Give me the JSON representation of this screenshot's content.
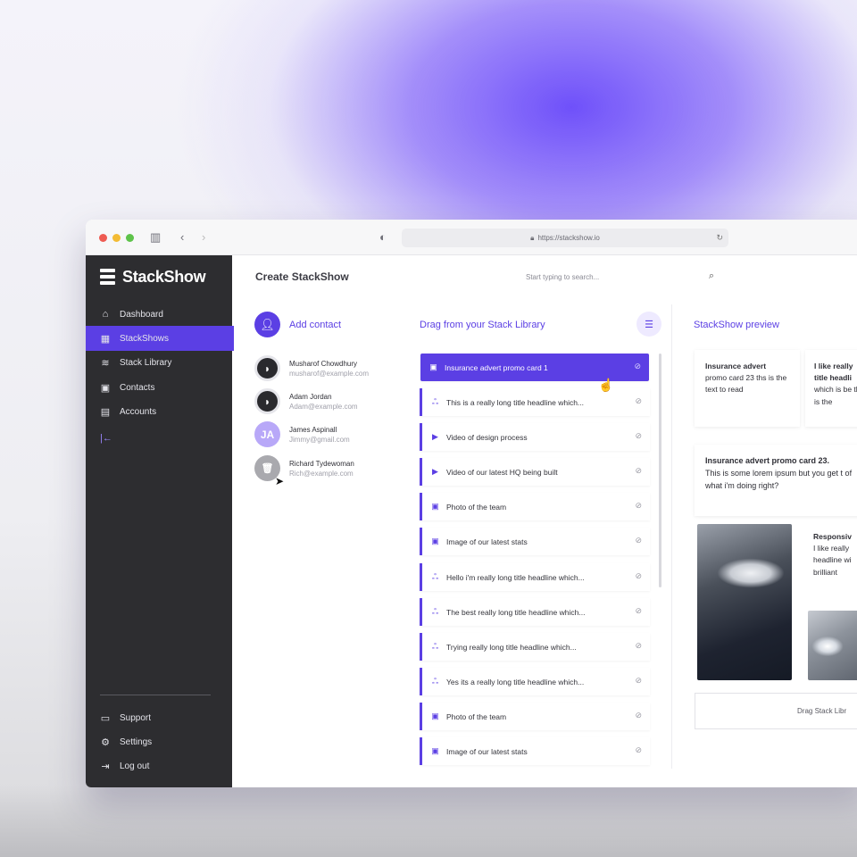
{
  "browser": {
    "url": "https://stackshow.io"
  },
  "app": {
    "name": "StackShow"
  },
  "sidebar": {
    "items": [
      {
        "label": "Dashboard",
        "icon": "home-icon"
      },
      {
        "label": "StackShows",
        "icon": "grid-icon",
        "active": true
      },
      {
        "label": "Stack Library",
        "icon": "layers-icon"
      },
      {
        "label": "Contacts",
        "icon": "contact-card-icon"
      },
      {
        "label": "Accounts",
        "icon": "building-icon"
      }
    ],
    "bottom_items": [
      {
        "label": "Support",
        "icon": "chat-icon"
      },
      {
        "label": "Settings",
        "icon": "gear-icon"
      },
      {
        "label": "Log out",
        "icon": "logout-icon"
      }
    ]
  },
  "header": {
    "title": "Create StackShow",
    "search_placeholder": "Start typing to search..."
  },
  "contacts": {
    "add_label": "Add contact",
    "list": [
      {
        "name": "Musharof Chowdhury",
        "email": "musharof@example.com",
        "avatar": "photo"
      },
      {
        "name": "Adam Jordan",
        "email": "Adam@example.com",
        "avatar": "photo"
      },
      {
        "name": "James Aspinall",
        "email": "Jimmy@gmail.com",
        "avatar": "initials",
        "initials": "JA"
      },
      {
        "name": "Richard Tydewoman",
        "email": "Rich@example.com",
        "avatar": "trash"
      }
    ]
  },
  "library": {
    "title": "Drag from your Stack Library",
    "items": [
      {
        "label": "Insurance advert promo card 1",
        "icon": "image-card-icon",
        "selected": true
      },
      {
        "label": "This is a really long title headline which...",
        "icon": "people-icon"
      },
      {
        "label": "Video of design process",
        "icon": "video-icon"
      },
      {
        "label": "Video of our latest HQ being built",
        "icon": "video-icon"
      },
      {
        "label": "Photo of the team",
        "icon": "image-card-icon"
      },
      {
        "label": "Image of our latest stats",
        "icon": "image-card-icon"
      },
      {
        "label": "Hello i'm really long title headline which...",
        "icon": "people-icon"
      },
      {
        "label": "The best really long title headline which...",
        "icon": "people-icon"
      },
      {
        "label": "Trying really long title headline which...",
        "icon": "people-icon"
      },
      {
        "label": "Yes its a really long title headline which...",
        "icon": "people-icon"
      },
      {
        "label": "Photo of the team",
        "icon": "image-card-icon"
      },
      {
        "label": "Image of our latest stats",
        "icon": "image-card-icon"
      }
    ]
  },
  "preview": {
    "title": "StackShow preview",
    "card1": {
      "bold": "Insurance advert",
      "text": "promo card 23 ths is the text to read"
    },
    "card2": {
      "bold": "I like really title headli",
      "text": "which is be this is the"
    },
    "card3": {
      "bold": "Insurance advert promo card 23.",
      "text": "This is some lorem ipsum but you get t of what i'm doing right?"
    },
    "card4": {
      "bold": "Responsiv",
      "text": "I like really headline wi brilliant"
    },
    "drag_hint": "Drag Stack Libr"
  }
}
